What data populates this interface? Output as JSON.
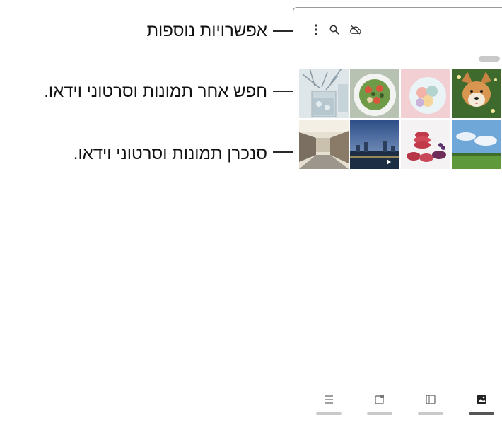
{
  "callouts": {
    "more_options": "אפשרויות נוספות",
    "search": "חפש אחר תמונות וסרטוני וידאו.",
    "sync": "סנכרן תמונות וסרטוני וידאו."
  },
  "toolbar": {
    "more_icon": "more-options-icon",
    "search_icon": "search-icon",
    "sync_icon": "cloud-sync-off-icon"
  },
  "gallery": {
    "thumbnails": [
      {
        "subject": "iced drink with branches"
      },
      {
        "subject": "salad plate"
      },
      {
        "subject": "macarons on pink plate"
      },
      {
        "subject": "corgi dog on grass"
      },
      {
        "subject": "street with buildings"
      },
      {
        "subject": "city skyline at dusk",
        "is_video": true
      },
      {
        "subject": "stack of macarons"
      },
      {
        "subject": "blue sky over field"
      }
    ]
  },
  "bottom_nav": {
    "items": [
      {
        "icon": "menu-icon"
      },
      {
        "icon": "stories-icon"
      },
      {
        "icon": "albums-icon"
      },
      {
        "icon": "pictures-icon",
        "active": true
      }
    ]
  }
}
